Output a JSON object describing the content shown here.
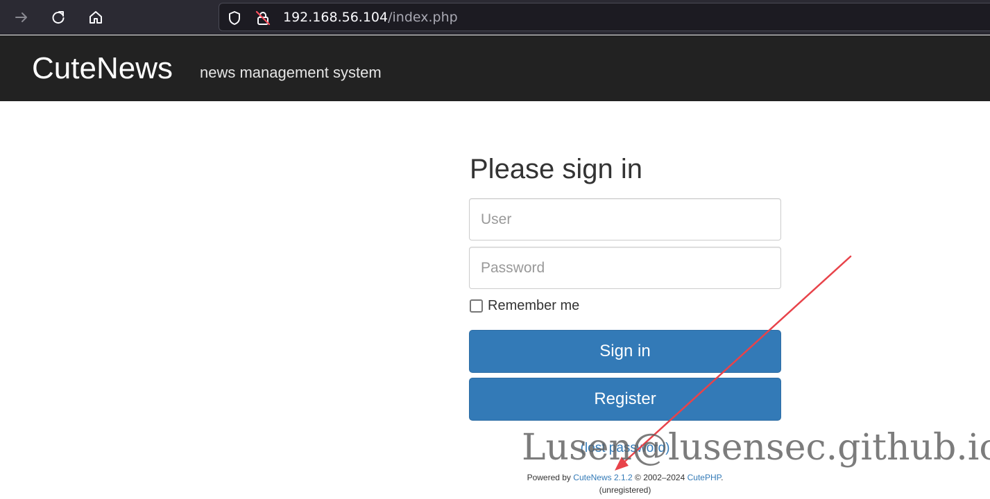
{
  "browser": {
    "url_host": "192.168.56.104",
    "url_path": "/index.php"
  },
  "header": {
    "brand": "CuteNews",
    "tagline": "news management system"
  },
  "signin": {
    "title": "Please sign in",
    "user_placeholder": "User",
    "password_placeholder": "Password",
    "remember_label": "Remember me",
    "remember_checked": false,
    "signin_label": "Sign in",
    "register_label": "Register",
    "lost_password": "(lost password)"
  },
  "footer": {
    "powered_by": "Powered by",
    "product_link": "CuteNews 2.1.2",
    "copyright": "© 2002–2024",
    "vendor_link": "CutePHP",
    "period": ".",
    "status": "(unregistered)"
  },
  "overlay": {
    "watermark": "Lusen@lusensec.github.io",
    "arrow_color": "#e8434a"
  },
  "colors": {
    "primary": "#337ab7",
    "header_bg": "#222222",
    "toolbar_bg": "#2b2a33"
  }
}
